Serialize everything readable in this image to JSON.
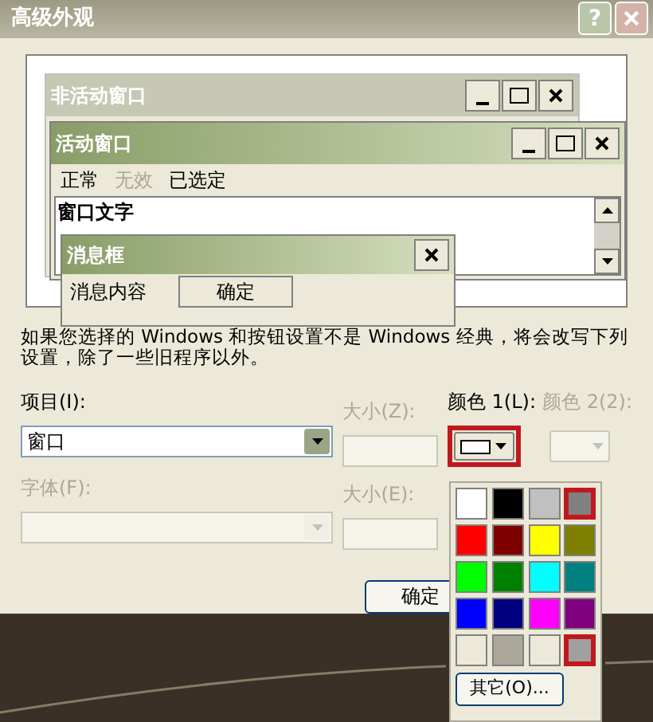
{
  "window": {
    "title": "高级外观",
    "help": "?"
  },
  "preview": {
    "inactive_window": {
      "title": "非活动窗口"
    },
    "active_window": {
      "title": "活动窗口",
      "menu": [
        {
          "label": "正常",
          "disabled": false
        },
        {
          "label": "无效",
          "disabled": true
        },
        {
          "label": "已选定",
          "disabled": false
        }
      ],
      "window_text": "窗口文字"
    },
    "message_box": {
      "title": "消息框",
      "text": "消息内容",
      "button": "确定"
    }
  },
  "note": "如果您选择的 Windows 和按钮设置不是 Windows 经典，将会改写下列设置，除了一些旧程序以外。",
  "item": {
    "label": "项目(I):",
    "value": "窗口",
    "disabled": false
  },
  "item_size": {
    "label": "大小(Z):",
    "disabled": true
  },
  "color1": {
    "label": "颜色 1(L):",
    "color": "#ffffff",
    "disabled": false
  },
  "color2": {
    "label": "颜色 2(2):",
    "disabled": true
  },
  "font": {
    "label": "字体(F):",
    "disabled": true
  },
  "font_size": {
    "label": "大小(E):",
    "disabled": true
  },
  "ok_button": "确定",
  "palette": {
    "swatches": [
      {
        "color": "#ffffff",
        "highlighted": false
      },
      {
        "color": "#000000",
        "highlighted": false
      },
      {
        "color": "#c0c0c0",
        "highlighted": false
      },
      {
        "color": "#808080",
        "highlighted": true
      },
      {
        "color": "#ff0000",
        "highlighted": false
      },
      {
        "color": "#800000",
        "highlighted": false
      },
      {
        "color": "#ffff00",
        "highlighted": false
      },
      {
        "color": "#808000",
        "highlighted": false
      },
      {
        "color": "#00ff00",
        "highlighted": false
      },
      {
        "color": "#008000",
        "highlighted": false
      },
      {
        "color": "#00ffff",
        "highlighted": false
      },
      {
        "color": "#008080",
        "highlighted": false
      },
      {
        "color": "#0000ff",
        "highlighted": false
      },
      {
        "color": "#000080",
        "highlighted": false
      },
      {
        "color": "#ff00ff",
        "highlighted": false
      },
      {
        "color": "#800080",
        "highlighted": false
      },
      {
        "color": "#ece9d8",
        "highlighted": false
      },
      {
        "color": "#aca899",
        "highlighted": false
      },
      {
        "color": "#ece9d8",
        "highlighted": false
      },
      {
        "color": "#a0a0a0",
        "highlighted": true
      }
    ],
    "other_button": "其它(O)..."
  }
}
